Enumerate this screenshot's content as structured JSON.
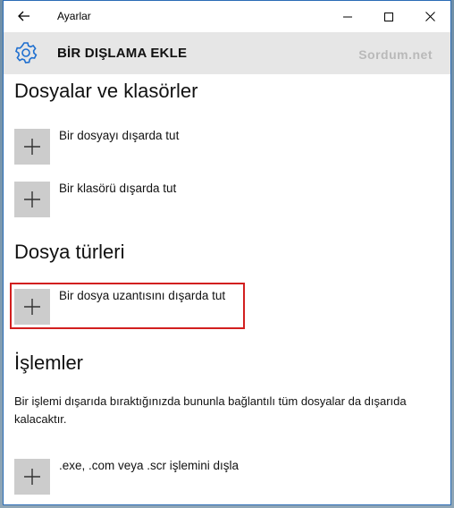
{
  "window": {
    "title": "Ayarlar"
  },
  "header": {
    "title": "BİR DIŞLAMA EKLE",
    "watermark": "Sordum.net"
  },
  "sections": {
    "files": {
      "title": "Dosyalar ve klasörler",
      "add_file": "Bir dosyayı dışarda tut",
      "add_folder": "Bir klasörü dışarda tut"
    },
    "types": {
      "title": "Dosya türleri",
      "add_extension": "Bir dosya uzantısını dışarda tut"
    },
    "processes": {
      "title": "İşlemler",
      "description": "Bir işlemi dışarıda bıraktığınızda bununla bağlantılı tüm dosyalar da dışarıda kalacaktır.",
      "add_process": ".exe, .com veya .scr işlemini dışla"
    }
  },
  "colors": {
    "accent": "#1e6fd0",
    "highlight": "#d21f1f",
    "plus_bg": "#cccccc",
    "header_bg": "#e6e6e6"
  }
}
